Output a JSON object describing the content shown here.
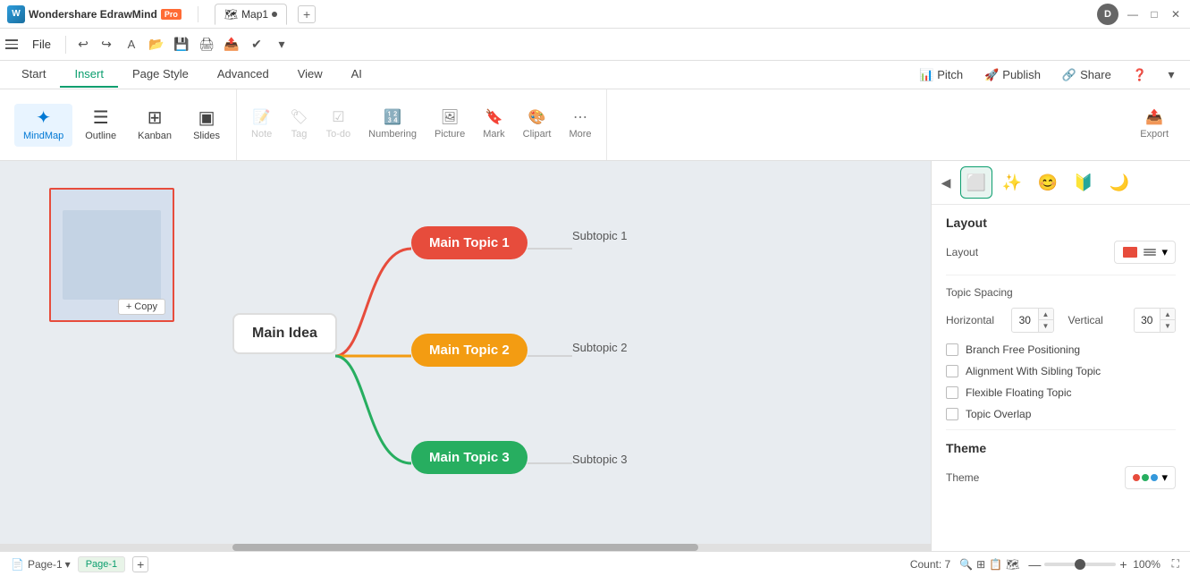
{
  "app": {
    "name": "Wondershare EdrawMind",
    "pro_badge": "Pro",
    "tab_name": "Map1",
    "user_initial": "D"
  },
  "titlebar": {
    "window_minimize": "—",
    "window_maximize": "□",
    "window_close": "✕"
  },
  "menubar": {
    "file": "File",
    "undo_label": "↩",
    "redo_label": "↪"
  },
  "ribbon": {
    "tabs": [
      "Start",
      "Insert",
      "Page Style",
      "Advanced",
      "View",
      "AI"
    ],
    "active_tab": "Insert",
    "pitch": "Pitch",
    "publish": "Publish",
    "share": "Share",
    "help": "?"
  },
  "toolbar": {
    "tools": [
      {
        "id": "mindmap",
        "label": "MindMap",
        "icon": "✦"
      },
      {
        "id": "outline",
        "label": "Outline",
        "icon": "☰"
      },
      {
        "id": "kanban",
        "label": "Kanban",
        "icon": "⊞"
      },
      {
        "id": "slides",
        "label": "Slides",
        "icon": "▣"
      }
    ],
    "insert_tools": [
      {
        "id": "note",
        "label": "Note",
        "icon": "📝",
        "disabled": true
      },
      {
        "id": "tag",
        "label": "Tag",
        "icon": "🏷",
        "disabled": true
      },
      {
        "id": "todo",
        "label": "To-do",
        "icon": "☑",
        "disabled": true
      },
      {
        "id": "numbering",
        "label": "Numbering",
        "icon": "🔢",
        "disabled": false
      },
      {
        "id": "picture",
        "label": "Picture",
        "icon": "🖼",
        "disabled": false
      },
      {
        "id": "mark",
        "label": "Mark",
        "icon": "🔖",
        "disabled": false
      },
      {
        "id": "clipart",
        "label": "Clipart",
        "icon": "🎨",
        "disabled": false
      },
      {
        "id": "more",
        "label": "More",
        "icon": "⋯",
        "disabled": false
      }
    ],
    "export": "Export"
  },
  "canvas": {
    "layout_preview_copy": "+ Copy",
    "main_idea": "Main Idea",
    "topics": [
      {
        "id": "t1",
        "label": "Main Topic 1",
        "color": "#e74c3c",
        "subtopic": "Subtopic 1"
      },
      {
        "id": "t2",
        "label": "Main Topic 2",
        "color": "#f39c12",
        "subtopic": "Subtopic 2"
      },
      {
        "id": "t3",
        "label": "Main Topic 3",
        "color": "#27ae60",
        "subtopic": "Subtopic 3"
      }
    ]
  },
  "right_panel": {
    "icons": [
      {
        "id": "layout",
        "icon": "⬜",
        "active": true
      },
      {
        "id": "sparkle",
        "icon": "✨",
        "active": false
      },
      {
        "id": "emoji",
        "icon": "😊",
        "active": false
      },
      {
        "id": "shield",
        "icon": "🔰",
        "active": false
      },
      {
        "id": "moon",
        "icon": "🌙",
        "active": false
      }
    ],
    "layout_section": "Layout",
    "layout_label": "Layout",
    "spacing_section": "Topic Spacing",
    "horizontal_label": "Horizontal",
    "horizontal_value": "30",
    "vertical_label": "Vertical",
    "vertical_value": "30",
    "checkboxes": [
      {
        "id": "branch_free",
        "label": "Branch Free Positioning",
        "checked": false
      },
      {
        "id": "alignment",
        "label": "Alignment With Sibling Topic",
        "checked": false
      },
      {
        "id": "flexible",
        "label": "Flexible Floating Topic",
        "checked": false
      },
      {
        "id": "overlap",
        "label": "Topic Overlap",
        "checked": false
      }
    ],
    "theme_section": "Theme",
    "theme_label": "Theme",
    "theme_colors": [
      "#e74c3c",
      "#27ae60",
      "#3498db",
      "#f39c12"
    ]
  },
  "statusbar": {
    "page_label": "Page-1",
    "page_tab": "Page-1",
    "add_page": "+",
    "count_label": "Count: 7",
    "zoom_level": "100%",
    "zoom_in": "+",
    "zoom_out": "—"
  }
}
